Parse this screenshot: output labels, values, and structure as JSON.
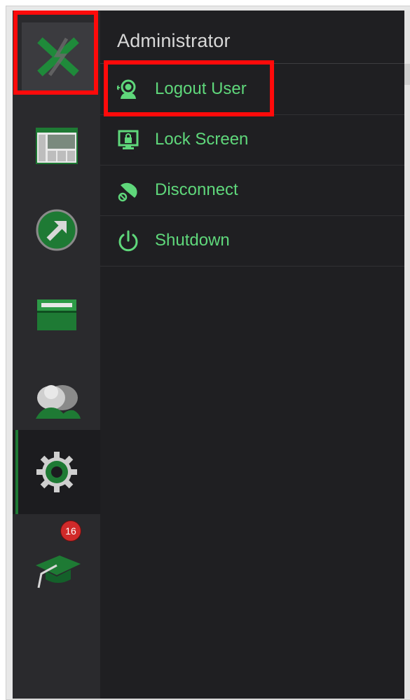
{
  "panel": {
    "title": "Administrator",
    "items": [
      {
        "label": "Logout User",
        "icon": "user-logout-icon"
      },
      {
        "label": "Lock Screen",
        "icon": "lock-screen-icon"
      },
      {
        "label": "Disconnect",
        "icon": "disconnect-icon"
      },
      {
        "label": "Shutdown",
        "icon": "power-icon"
      }
    ]
  },
  "sidebar": {
    "items": [
      {
        "icon": "app-logo-icon"
      },
      {
        "icon": "dashboard-icon"
      },
      {
        "icon": "arrow-up-right-icon"
      },
      {
        "icon": "folder-icon"
      },
      {
        "icon": "users-icon"
      },
      {
        "icon": "gear-icon",
        "active": true
      },
      {
        "icon": "graduation-cap-icon",
        "badge": "16"
      }
    ]
  },
  "colors": {
    "accent_green": "#5fd77b",
    "dark_green": "#1e7a34",
    "highlight_red": "#ff0a0a",
    "sidebar_bg": "#2a2a2d",
    "panel_bg": "#1f1f22",
    "badge_red": "#d02a2a"
  }
}
